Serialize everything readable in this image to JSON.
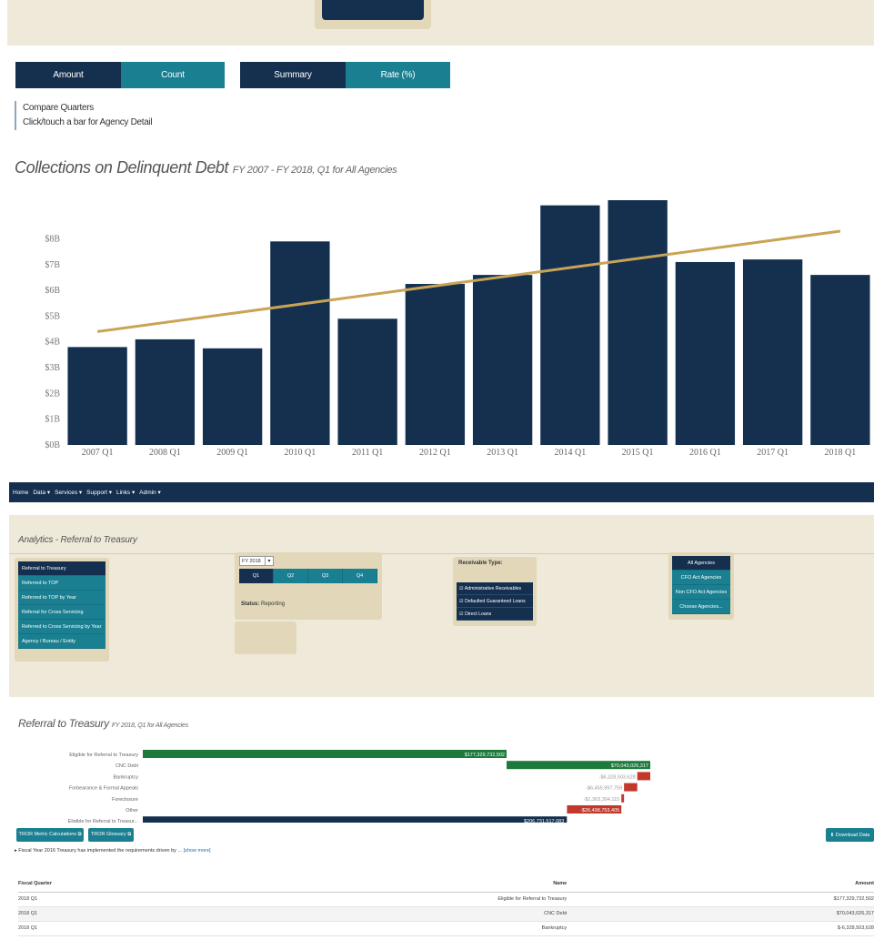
{
  "top": {
    "toggles_metric": [
      "Amount",
      "Count"
    ],
    "toggles_view": [
      "Summary",
      "Rate (%)"
    ],
    "notes": [
      "Compare Quarters",
      "Click/touch a bar for Agency Detail"
    ],
    "chart_title": "Collections on Delinquent Debt",
    "chart_subtitle": "FY 2007 - FY 2018, Q1 for All Agencies"
  },
  "chart_data": {
    "type": "bar",
    "title": "Collections on Delinquent Debt",
    "subtitle": "FY 2007 - FY 2018, Q1 for All Agencies",
    "categories": [
      "2007 Q1",
      "2008 Q1",
      "2009 Q1",
      "2010 Q1",
      "2011 Q1",
      "2012 Q1",
      "2013 Q1",
      "2014 Q1",
      "2015 Q1",
      "2016 Q1",
      "2017 Q1",
      "2018 Q1"
    ],
    "values": [
      3.8,
      4.1,
      3.75,
      7.9,
      4.9,
      6.25,
      6.6,
      9.3,
      9.5,
      7.1,
      7.2,
      6.6
    ],
    "trendline": {
      "start": 4.4,
      "end": 8.3
    },
    "yticks": [
      "$0B",
      "$1B",
      "$2B",
      "$3B",
      "$4B",
      "$5B",
      "$6B",
      "$7B",
      "$8B"
    ],
    "ylim": [
      0,
      9.5
    ],
    "colors": {
      "bar": "#15304f",
      "trend": "#c9a456"
    }
  },
  "bottom": {
    "nav": [
      "Home",
      "Data ▾",
      "Services ▾",
      "Support ▾",
      "Links ▾",
      "Admin ▾"
    ],
    "panel_title": "Analytics - Referral to Treasury",
    "menu": [
      "Referral to Treasury",
      "Referred to TOP",
      "Referred to TOP by Year",
      "Referral for Cross Servicing",
      "Referred to Cross Servicing by Year",
      "Agency / Bureau / Entity"
    ],
    "fy_select": "FY 2018",
    "quarters": [
      "Q1",
      "Q2",
      "Q3",
      "Q4"
    ],
    "status_label": "Status:",
    "status_value": "Reporting",
    "receivable_title": "Receivable Type:",
    "receivables": [
      "☑ Administrative Receivables",
      "☑ Defaulted Guaranteed Loans",
      "☑ Direct Loans"
    ],
    "agencies": [
      "All Agencies",
      "CFO Act Agencies",
      "Non CFO Act Agencies",
      "Choose Agencies..."
    ],
    "rt_title": "Referral to Treasury",
    "rt_subtitle": "FY 2018, Q1 for All Agencies",
    "buttons": {
      "calc": "TROR Metric Calculations ⧉",
      "glossary": "TROR Glossary ⧉",
      "download": "⬇ Download Data"
    },
    "note": "▸ Fiscal Year 2016 Treasury has implemented the requirements driven by ...",
    "note_link": "[show more]",
    "table_headers": {
      "quarter": "Fiscal Quarter",
      "name": "Name",
      "amount": "Amount"
    },
    "table_rows": [
      {
        "quarter": "2018 Q1",
        "name": "Eligible for Referral to Treasury",
        "amount": "$177,329,732,502"
      },
      {
        "quarter": "2018 Q1",
        "name": "CNC Debt",
        "amount": "$70,043,026,317"
      },
      {
        "quarter": "2018 Q1",
        "name": "Bankruptcy",
        "amount": "$-6,328,503,628"
      }
    ]
  },
  "waterfall": {
    "labels": [
      "Eligible for Referral to Treasury",
      "CNC Debt",
      "Bankruptcy",
      "Forbearance & Formal Appeals",
      "Foreclosure",
      "Other",
      "Eligible for Referral to Treasur..."
    ],
    "value_labels": [
      "$177,329,732,502",
      "$70,043,026,317",
      "-$6,328,503,628",
      "-$6,455,997,759",
      "-$1,303,304,115",
      "-$26,498,753,405",
      "$206,731,517,083"
    ],
    "starts": [
      0,
      177.33,
      247.37,
      241.04,
      234.58,
      233.28,
      0
    ],
    "ends": [
      177.33,
      247.37,
      241.04,
      234.58,
      233.28,
      206.78,
      206.73
    ],
    "colors": [
      "#1e7a3c",
      "#1e7a3c",
      "#c0392b",
      "#c0392b",
      "#c0392b",
      "#c0392b",
      "#15304f"
    ]
  }
}
